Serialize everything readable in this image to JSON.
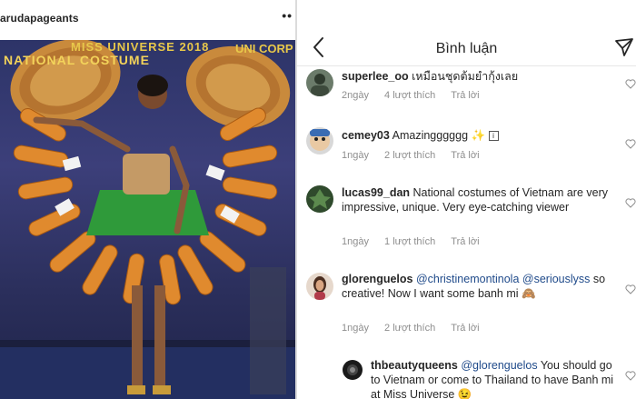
{
  "post": {
    "username": "arudapageants",
    "more_label": "••",
    "banner_line1": "MISS UNIVERSE 2018",
    "banner_line2": "NATIONAL COSTUME",
    "banner_corp": "UNI CORP"
  },
  "comments_screen": {
    "title": "Bình luận",
    "back_icon": "chevron-left-icon",
    "send_icon": "paper-plane-icon",
    "comments": [
      {
        "user": "superlee_oo",
        "text": "เหมือนชุดต้มยำกุ้งเลย",
        "time": "2ngày",
        "likes": "4 lượt thích",
        "reply": "Trả lời"
      },
      {
        "user": "cemey03",
        "text": "Amazingggggg ✨",
        "time": "1ngày",
        "likes": "2 lượt thích",
        "reply": "Trả lời"
      },
      {
        "user": "lucas99_dan",
        "text": "National costumes of Vietnam are very impressive, unique. Very eye-catching viewer",
        "time": "1ngày",
        "likes": "1 lượt thích",
        "reply": "Trả lời"
      },
      {
        "user": "glorenguelos",
        "mention1": "@christinemontinola",
        "mention2": "@seriouslyss",
        "text": " so creative! Now I want some banh mi 🙈",
        "time": "1ngày",
        "likes": "2 lượt thích",
        "reply": "Trả lời"
      },
      {
        "user": "thbeautyqueens",
        "mention1": "@glorenguelos",
        "text": " You should go to Vietnam or come to Thailand to have Banh mi at Miss Universe 😉"
      }
    ]
  },
  "colors": {
    "username": "#262626",
    "meta": "#8e8e8e",
    "mention": "#1f4a8a",
    "stage": "#2d3468"
  }
}
